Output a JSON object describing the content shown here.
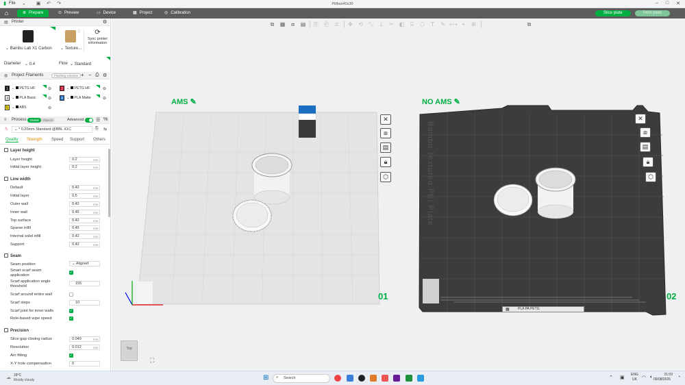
{
  "titlebar": {
    "file_menu": "File",
    "title": "Pillbox40x30"
  },
  "nav": {
    "tabs": [
      {
        "label": "Prepare"
      },
      {
        "label": "Preview"
      },
      {
        "label": "Device"
      },
      {
        "label": "Project"
      },
      {
        "label": "Calibration"
      }
    ],
    "slice_button": "Slice plate",
    "print_button": "Print plate"
  },
  "printer": {
    "section_title": "Printer",
    "name": "Bambu Lab X1 Carbon",
    "plate": "Texture...",
    "sync_label_1": "Sync printer",
    "sync_label_2": "information",
    "diameter_label": "Diameter",
    "diameter_value": "0.4",
    "flow_label": "Flow",
    "flow_value": "Standard"
  },
  "filaments": {
    "section_title": "Project Filaments",
    "flushing_button": "Flushing volumes",
    "items": [
      {
        "num": "1",
        "name": "PETG HF",
        "color": "#111111"
      },
      {
        "num": "2",
        "name": "PETG HF",
        "color": "#c8102e"
      },
      {
        "num": "3",
        "name": "PLA Basic",
        "color": "#ffffff"
      },
      {
        "num": "4",
        "name": "PLA Matte",
        "color": "#1c6fc0"
      },
      {
        "num": "5",
        "name": "ABS",
        "color": "#f5e31a"
      }
    ]
  },
  "process": {
    "section_title": "Process",
    "global_label": "Global",
    "objects_label": "Objects",
    "advanced_label": "Advanced",
    "preset": "* 0.20mm Standard @BBL X1C",
    "tabs": [
      "Quality",
      "Strength",
      "Speed",
      "Support",
      "Others"
    ]
  },
  "layer_height": {
    "title": "Layer height",
    "rows": [
      {
        "label": "Layer height",
        "value": "0.2",
        "unit": "mm"
      },
      {
        "label": "Initial layer height",
        "value": "0.2",
        "unit": "mm"
      }
    ]
  },
  "line_width": {
    "title": "Line width",
    "rows": [
      {
        "label": "Default",
        "value": "0.42",
        "unit": "mm"
      },
      {
        "label": "Initial layer",
        "value": "0.5",
        "unit": "mm"
      },
      {
        "label": "Outer wall",
        "value": "0.42",
        "unit": "mm"
      },
      {
        "label": "Inner wall",
        "value": "0.45",
        "unit": "mm"
      },
      {
        "label": "Top surface",
        "value": "0.42",
        "unit": "mm"
      },
      {
        "label": "Sparse infill",
        "value": "0.45",
        "unit": "mm"
      },
      {
        "label": "Internal solid infill",
        "value": "0.42",
        "unit": "mm"
      },
      {
        "label": "Support",
        "value": "0.42",
        "unit": "mm"
      }
    ]
  },
  "seam": {
    "title": "Seam",
    "seam_position_label": "Seam position",
    "seam_position_value": "Aligned",
    "smart_scarf_label_1": "Smart scarf seam",
    "smart_scarf_label_2": "application",
    "scarf_angle_label_1": "Scarf application angle",
    "scarf_angle_label_2": "threshold",
    "scarf_angle_value": "155",
    "scarf_entire_label": "Scarf around entire wall",
    "scarf_steps_label": "Scarf steps",
    "scarf_steps_value": "10",
    "scarf_inner_label": "Scarf joint for inner walls",
    "role_wipe_label": "Role-based wipe speed"
  },
  "precision": {
    "title": "Precision",
    "rows": [
      {
        "label": "Slice gap closing radius",
        "value": "0.049",
        "unit": "mm"
      },
      {
        "label": "Resolution",
        "value": "0.012",
        "unit": "mm"
      }
    ],
    "arc_label": "Arc fitting",
    "xy_hole_label": "X-Y hole compensation",
    "xy_hole_value": "0"
  },
  "canvas": {
    "plate1_label": "AMS",
    "plate1_num": "01",
    "plate2_label": "NO AMS",
    "plate2_num": "02",
    "plate2_text": "Bambu Textured PEI Plate",
    "plate2_footer": "PLA PA PETG",
    "view_cube": "Top"
  },
  "taskbar": {
    "weather_temp": "18°C",
    "weather_desc": "Mostly cloudy",
    "search": "Search",
    "lang_1": "ENG",
    "lang_2": "UK",
    "time": "21:03",
    "date": "09/08/2025"
  }
}
